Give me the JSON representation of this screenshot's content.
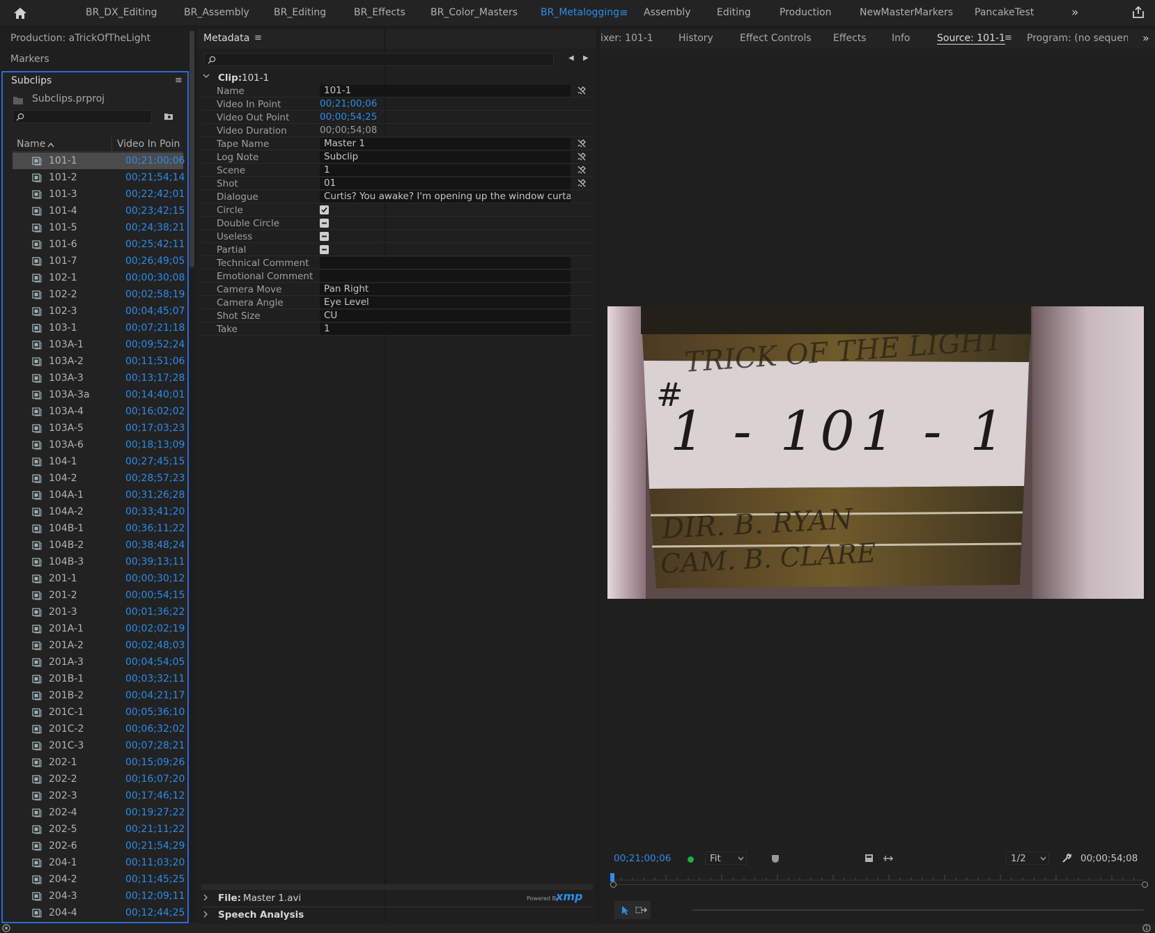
{
  "workspaces": {
    "tabs": [
      "BR_DX_Editing",
      "BR_Assembly",
      "BR_Editing",
      "BR_Effects",
      "BR_Color_Masters",
      "BR_Metalogging",
      "Assembly",
      "Editing",
      "Production",
      "NewMasterMarkers",
      "PancakeTest"
    ],
    "active": "BR_Metalogging"
  },
  "left": {
    "production_title": "Production: aTrickOfTheLight",
    "markers_title": "Markers",
    "subclips_title": "Subclips",
    "project_file": "Subclips.prproj",
    "col_name": "Name",
    "col_in": "Video In Poin",
    "rows": [
      {
        "name": "101-1",
        "in": "00;21;00;06"
      },
      {
        "name": "101-2",
        "in": "00;21;54;14"
      },
      {
        "name": "101-3",
        "in": "00;22;42;01"
      },
      {
        "name": "101-4",
        "in": "00;23;42;15"
      },
      {
        "name": "101-5",
        "in": "00;24;38;21"
      },
      {
        "name": "101-6",
        "in": "00;25;42;11"
      },
      {
        "name": "101-7",
        "in": "00;26;49;05"
      },
      {
        "name": "102-1",
        "in": "00;00;30;08"
      },
      {
        "name": "102-2",
        "in": "00;02;58;19"
      },
      {
        "name": "102-3",
        "in": "00;04;45;07"
      },
      {
        "name": "103-1",
        "in": "00;07;21;18"
      },
      {
        "name": "103A-1",
        "in": "00;09;52;24"
      },
      {
        "name": "103A-2",
        "in": "00;11;51;06"
      },
      {
        "name": "103A-3",
        "in": "00;13;17;28"
      },
      {
        "name": "103A-3a",
        "in": "00;14;40;01"
      },
      {
        "name": "103A-4",
        "in": "00;16;02;02"
      },
      {
        "name": "103A-5",
        "in": "00;17;03;23"
      },
      {
        "name": "103A-6",
        "in": "00;18;13;09"
      },
      {
        "name": "104-1",
        "in": "00;27;45;15"
      },
      {
        "name": "104-2",
        "in": "00;28;57;23"
      },
      {
        "name": "104A-1",
        "in": "00;31;26;28"
      },
      {
        "name": "104A-2",
        "in": "00;33;41;20"
      },
      {
        "name": "104B-1",
        "in": "00;36;11;22"
      },
      {
        "name": "104B-2",
        "in": "00;38;48;24"
      },
      {
        "name": "104B-3",
        "in": "00;39;13;11"
      },
      {
        "name": "201-1",
        "in": "00;00;30;12"
      },
      {
        "name": "201-2",
        "in": "00;00;54;15"
      },
      {
        "name": "201-3",
        "in": "00;01;36;22"
      },
      {
        "name": "201A-1",
        "in": "00;02;02;19"
      },
      {
        "name": "201A-2",
        "in": "00;02;48;03"
      },
      {
        "name": "201A-3",
        "in": "00;04;54;05"
      },
      {
        "name": "201B-1",
        "in": "00;03;32;11"
      },
      {
        "name": "201B-2",
        "in": "00;04;21;17"
      },
      {
        "name": "201C-1",
        "in": "00;05;36;10"
      },
      {
        "name": "201C-2",
        "in": "00;06;32;02"
      },
      {
        "name": "201C-3",
        "in": "00;07;28;21"
      },
      {
        "name": "202-1",
        "in": "00;15;09;26"
      },
      {
        "name": "202-2",
        "in": "00;16;07;20"
      },
      {
        "name": "202-3",
        "in": "00;17;46;12"
      },
      {
        "name": "202-4",
        "in": "00;19;27;22"
      },
      {
        "name": "202-5",
        "in": "00;21;11;22"
      },
      {
        "name": "202-6",
        "in": "00;21;54;29"
      },
      {
        "name": "204-1",
        "in": "00;11;03;20"
      },
      {
        "name": "204-2",
        "in": "00;11;45;25"
      },
      {
        "name": "204-3",
        "in": "00;12;09;11"
      },
      {
        "name": "204-4",
        "in": "00;12;44;25"
      }
    ]
  },
  "metadata": {
    "title": "Metadata",
    "clip_label": "Clip:",
    "clip_name": "101-1",
    "fields": {
      "name": {
        "label": "Name",
        "value": "101-1"
      },
      "video_in": {
        "label": "Video In Point",
        "value": "00;21;00;06"
      },
      "video_out": {
        "label": "Video Out Point",
        "value": "00;00;54;25"
      },
      "video_duration": {
        "label": "Video Duration",
        "value": "00;00;54;08"
      },
      "tape_name": {
        "label": "Tape Name",
        "value": "Master 1"
      },
      "log_note": {
        "label": "Log Note",
        "value": "Subclip"
      },
      "scene": {
        "label": "Scene",
        "value": "1"
      },
      "shot": {
        "label": "Shot",
        "value": "01"
      },
      "dialogue": {
        "label": "Dialogue",
        "value": "Curtis? You awake? I'm opening up the window curtains."
      },
      "circle": {
        "label": "Circle"
      },
      "double_circle": {
        "label": "Double Circle"
      },
      "useless": {
        "label": "Useless"
      },
      "partial": {
        "label": "Partial"
      },
      "technical_comment": {
        "label": "Technical Comment",
        "value": ""
      },
      "emotional_comment": {
        "label": "Emotional Comment",
        "value": ""
      },
      "camera_move": {
        "label": "Camera Move",
        "value": "Pan Right"
      },
      "camera_angle": {
        "label": "Camera Angle",
        "value": "Eye Level"
      },
      "shot_size": {
        "label": "Shot Size",
        "value": "CU"
      },
      "take": {
        "label": "Take",
        "value": "1"
      }
    },
    "file_label": "File:",
    "file_name": "Master 1.avi",
    "powered_by": "Powered By",
    "xmp": "xmp",
    "speech_analysis": "Speech Analysis"
  },
  "monitor": {
    "tabs": [
      "ixer: 101-1",
      "History",
      "Effect Controls",
      "Effects",
      "Info",
      "Source: 101-1",
      "Program: (no sequence"
    ],
    "active_tab": "Source: 101-1",
    "timecode": "00;21;00;06",
    "fit": "Fit",
    "resolution": "1/2",
    "duration": "00;00;54;08",
    "playhead_position": 0.0,
    "slate_lines": [
      "TRICK OF THE LIGHT",
      "#",
      "1 - 101 - 1",
      "DIR. B. RYAN",
      "CAM. B. CLARE"
    ]
  },
  "colors": {
    "accent": "#2d8ceb",
    "panel_bg": "#232323",
    "selection": "#4b4b4b"
  }
}
